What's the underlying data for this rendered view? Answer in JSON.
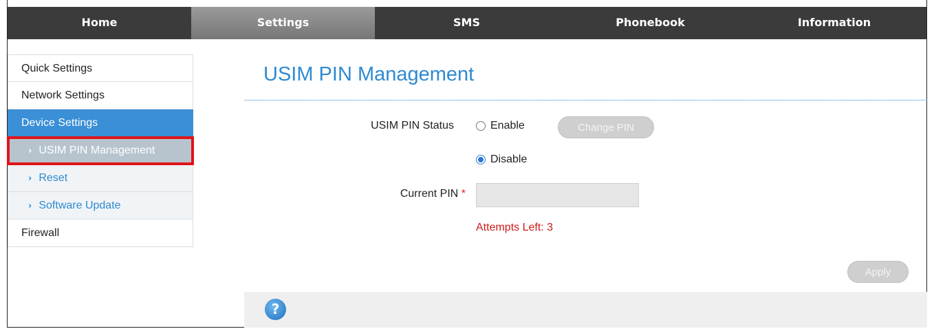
{
  "nav": {
    "tabs": [
      {
        "label": "Home"
      },
      {
        "label": "Settings"
      },
      {
        "label": "SMS"
      },
      {
        "label": "Phonebook"
      },
      {
        "label": "Information"
      }
    ],
    "active": "Settings"
  },
  "sidebar": {
    "items": [
      {
        "label": "Quick Settings"
      },
      {
        "label": "Network Settings"
      },
      {
        "label": "Device Settings"
      },
      {
        "label": "USIM PIN Management"
      },
      {
        "label": "Reset"
      },
      {
        "label": "Software Update"
      },
      {
        "label": "Firewall"
      }
    ],
    "chevron": "›"
  },
  "page": {
    "title": "USIM PIN Management"
  },
  "form": {
    "status_label": "USIM PIN Status",
    "enable_label": "Enable",
    "disable_label": "Disable",
    "selected_option": "Disable",
    "change_pin_label": "Change PIN",
    "current_pin_label": "Current PIN",
    "required_mark": "*",
    "current_pin_value": "",
    "attempts_text": "Attempts Left: 3",
    "apply_label": "Apply"
  },
  "footer": {
    "help_glyph": "?"
  },
  "colors": {
    "accent": "#2f8ad0",
    "nav_bg": "#3b3b3b",
    "active_sidebar": "#3a8fd6",
    "highlight_box": "#e0141a",
    "attempts": "#cc1a1a"
  }
}
